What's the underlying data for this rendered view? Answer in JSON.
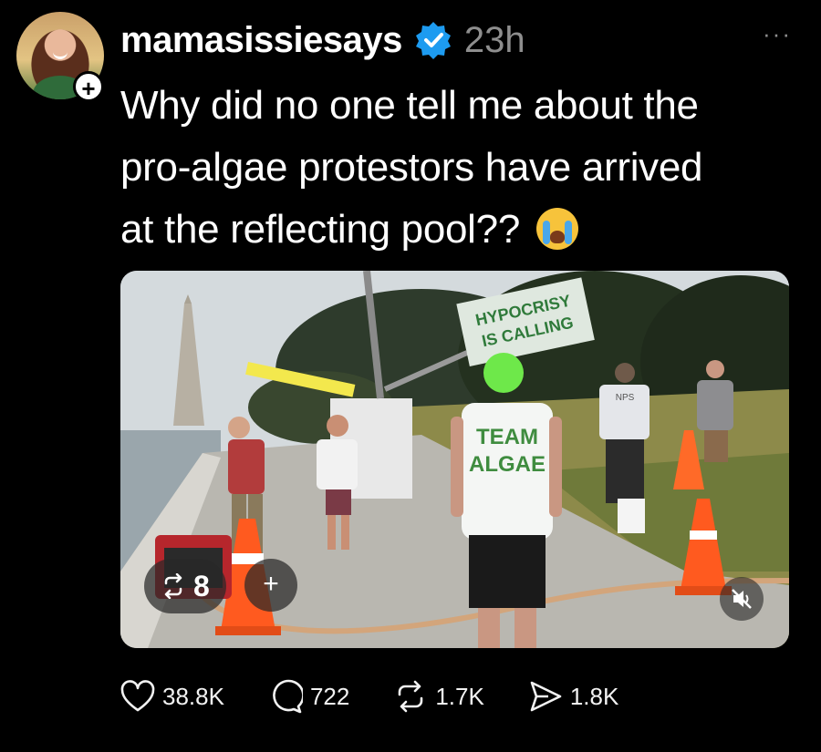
{
  "post": {
    "username": "mamasissiesays",
    "timestamp": "23h",
    "more_label": "···",
    "follow_label": "+",
    "caption_lines": [
      "Why did no one tell me about the",
      "pro-algae protestors have arrived",
      "at the reflecting pool??"
    ],
    "media": {
      "repost_count": "8",
      "add_label": "+",
      "banner_text": "HYPOCRISY IS CALLING",
      "shirt_text_line1": "TEAM",
      "shirt_text_line2": "ALGAE",
      "vest_text": "NPS"
    }
  },
  "actions": {
    "likes": "38.8K",
    "comments": "722",
    "reposts": "1.7K",
    "shares": "1.8K"
  },
  "colors": {
    "background": "#000000",
    "verified": "#1d9bf0",
    "muted_text": "#8e8e8e"
  },
  "icons": [
    "heart-icon",
    "comment-icon",
    "repost-icon",
    "share-icon",
    "verified-badge-icon",
    "mute-icon",
    "more-icon"
  ]
}
